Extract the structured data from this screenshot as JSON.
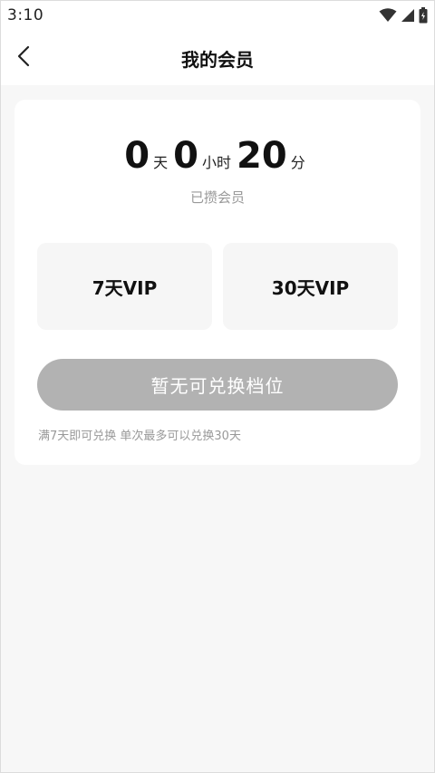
{
  "status_bar": {
    "time": "3:10",
    "icons": [
      "wifi-icon",
      "signal-icon",
      "battery-icon"
    ]
  },
  "header": {
    "title": "我的会员",
    "back_icon": "chevron-left-icon"
  },
  "summary": {
    "days": "0",
    "days_unit": "天",
    "hours": "0",
    "hours_unit": "小时",
    "minutes": "20",
    "minutes_unit": "分",
    "caption": "已攒会员"
  },
  "options": [
    {
      "label": "7天VIP"
    },
    {
      "label": "30天VIP"
    }
  ],
  "redeem_button": {
    "label": "暂无可兑换档位",
    "disabled": true
  },
  "hint": "满7天即可兑换 单次最多可以兑换30天",
  "colors": {
    "background": "#f7f7f7",
    "card": "#ffffff",
    "option_bg": "#f6f6f6",
    "button_disabled": "#b2b2b2",
    "muted_text": "#999999"
  }
}
